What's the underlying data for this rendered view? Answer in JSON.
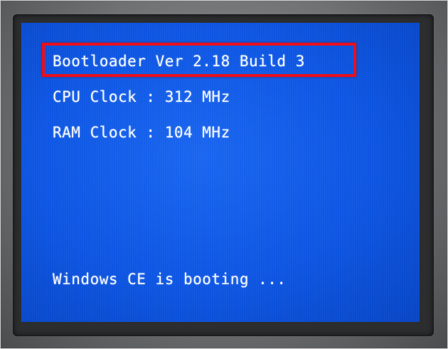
{
  "screen": {
    "lines": [
      "Bootloader Ver 2.18 Build 3",
      "CPU Clock : 312 MHz",
      "RAM Clock : 104 MHz",
      "Windows CE is booting ..."
    ]
  },
  "colors": {
    "screen_background": "#0d55e2",
    "text": "#f2f6ff",
    "highlight_border": "#e8101e",
    "bezel": "#6f7173"
  }
}
